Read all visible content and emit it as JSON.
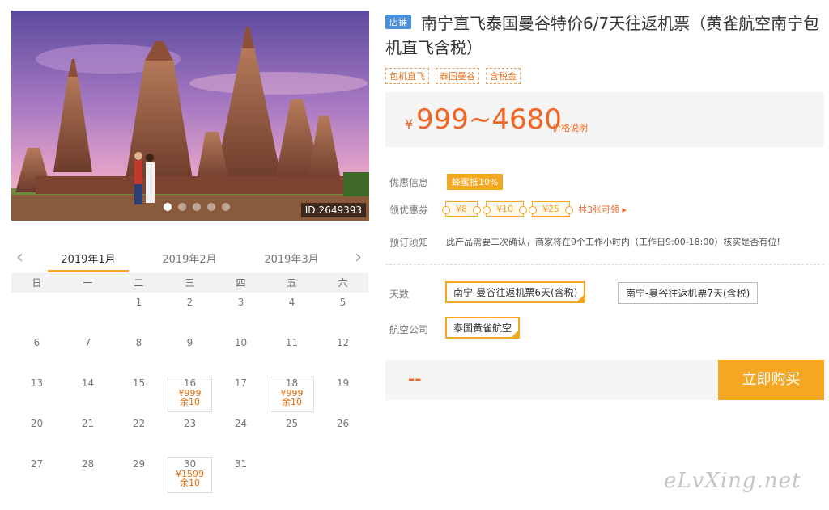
{
  "photo": {
    "id_label": "ID:2649393"
  },
  "calendar": {
    "months": [
      "2019年1月",
      "2019年2月",
      "2019年3月"
    ],
    "weekdays": [
      "日",
      "一",
      "二",
      "三",
      "四",
      "五",
      "六"
    ],
    "days": [
      {
        "d": ""
      },
      {
        "d": ""
      },
      {
        "d": "1"
      },
      {
        "d": "2"
      },
      {
        "d": "3"
      },
      {
        "d": "4"
      },
      {
        "d": "5"
      },
      {
        "d": "6"
      },
      {
        "d": "7"
      },
      {
        "d": "8"
      },
      {
        "d": "9"
      },
      {
        "d": "10"
      },
      {
        "d": "11"
      },
      {
        "d": "12"
      },
      {
        "d": "13"
      },
      {
        "d": "14"
      },
      {
        "d": "15"
      },
      {
        "d": "16",
        "price": "¥999",
        "stock": "余10"
      },
      {
        "d": "17"
      },
      {
        "d": "18",
        "price": "¥999",
        "stock": "余10"
      },
      {
        "d": "19"
      },
      {
        "d": "20"
      },
      {
        "d": "21"
      },
      {
        "d": "22"
      },
      {
        "d": "23"
      },
      {
        "d": "24"
      },
      {
        "d": "25"
      },
      {
        "d": "26"
      },
      {
        "d": "27"
      },
      {
        "d": "28"
      },
      {
        "d": "29"
      },
      {
        "d": "30",
        "price": "¥1599",
        "stock": "余10"
      },
      {
        "d": "31"
      },
      {
        "d": ""
      },
      {
        "d": ""
      }
    ]
  },
  "product": {
    "badge": "店铺",
    "title": "南宁直飞泰国曼谷特价6/7天往返机票（黄雀航空南宁包机直飞含税）",
    "tags": [
      "包机直飞",
      "泰国曼谷",
      "含税金"
    ],
    "price_symbol": "¥",
    "price_range": "999~4680",
    "price_note": "价格说明"
  },
  "info": {
    "promo_label": "优惠信息",
    "promo_value": "蜂蜜抵10%",
    "coupon_label": "领优惠券",
    "coupons": [
      "¥8",
      "¥10",
      "¥25"
    ],
    "coupon_count": "共3张可领 ▸",
    "notice_label": "预订须知",
    "notice_text": "此产品需要二次确认，商家将在9个工作小时内（工作日9:00-18:00）核实是否有位!"
  },
  "options": {
    "days_label": "天数",
    "days": [
      "南宁-曼谷往返机票6天(含税)",
      "南宁-曼谷往返机票7天(含税)"
    ],
    "airline_label": "航空公司",
    "airlines": [
      "泰国黄雀航空"
    ]
  },
  "purchase": {
    "total": "--",
    "buy_label": "立即购买"
  },
  "watermark": "eLvXing.net"
}
